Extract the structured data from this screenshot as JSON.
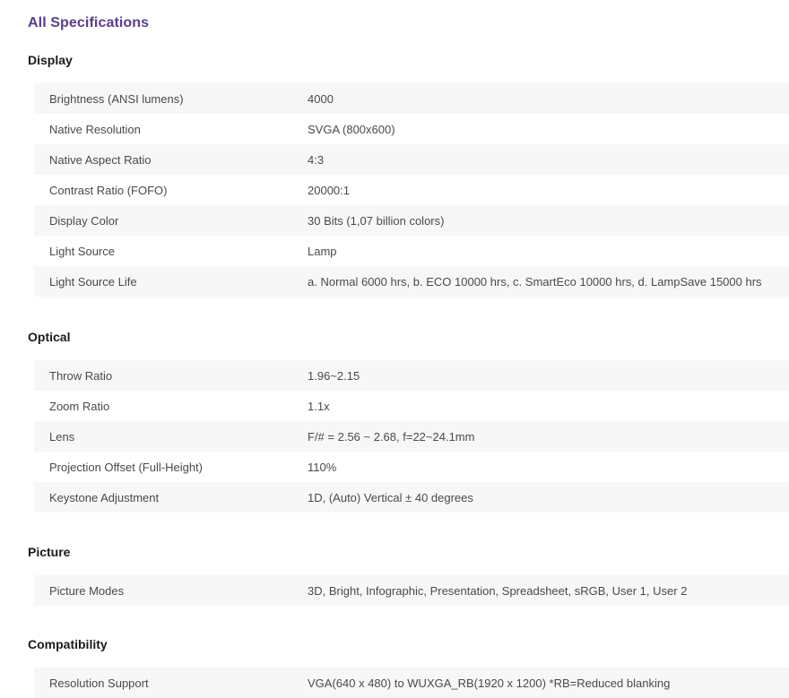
{
  "page_title": "All Specifications",
  "sections": [
    {
      "title": "Display",
      "rows": [
        {
          "label": "Brightness (ANSI lumens)",
          "value": "4000"
        },
        {
          "label": "Native Resolution",
          "value": "SVGA (800x600)"
        },
        {
          "label": "Native Aspect Ratio",
          "value": "4:3"
        },
        {
          "label": "Contrast Ratio (FOFO)",
          "value": "20000:1"
        },
        {
          "label": "Display Color",
          "value": "30 Bits (1,07 billion colors)"
        },
        {
          "label": "Light Source",
          "value": "Lamp"
        },
        {
          "label": "Light Source Life",
          "value": "a. Normal 6000 hrs, b. ECO 10000 hrs, c. SmartEco 10000 hrs, d. LampSave 15000 hrs"
        }
      ]
    },
    {
      "title": "Optical",
      "rows": [
        {
          "label": "Throw Ratio",
          "value": "1.96~2.15"
        },
        {
          "label": "Zoom Ratio",
          "value": "1.1x"
        },
        {
          "label": "Lens",
          "value": "F/# = 2.56 ~ 2.68, f=22~24.1mm"
        },
        {
          "label": "Projection Offset (Full-Height)",
          "value": "110%"
        },
        {
          "label": "Keystone Adjustment",
          "value": "1D, (Auto) Vertical ± 40 degrees"
        }
      ]
    },
    {
      "title": "Picture",
      "rows": [
        {
          "label": "Picture Modes",
          "value": "3D, Bright, Infographic, Presentation, Spreadsheet, sRGB, User 1, User 2"
        }
      ]
    },
    {
      "title": "Compatibility",
      "rows": [
        {
          "label": "Resolution Support",
          "value": "VGA(640 x 480) to WUXGA_RB(1920 x 1200) *RB=Reduced blanking"
        }
      ]
    }
  ],
  "colors": {
    "title": "#5a3d8a",
    "row_alt_bg": "#f7f7f7",
    "text": "#4a4a4a"
  }
}
